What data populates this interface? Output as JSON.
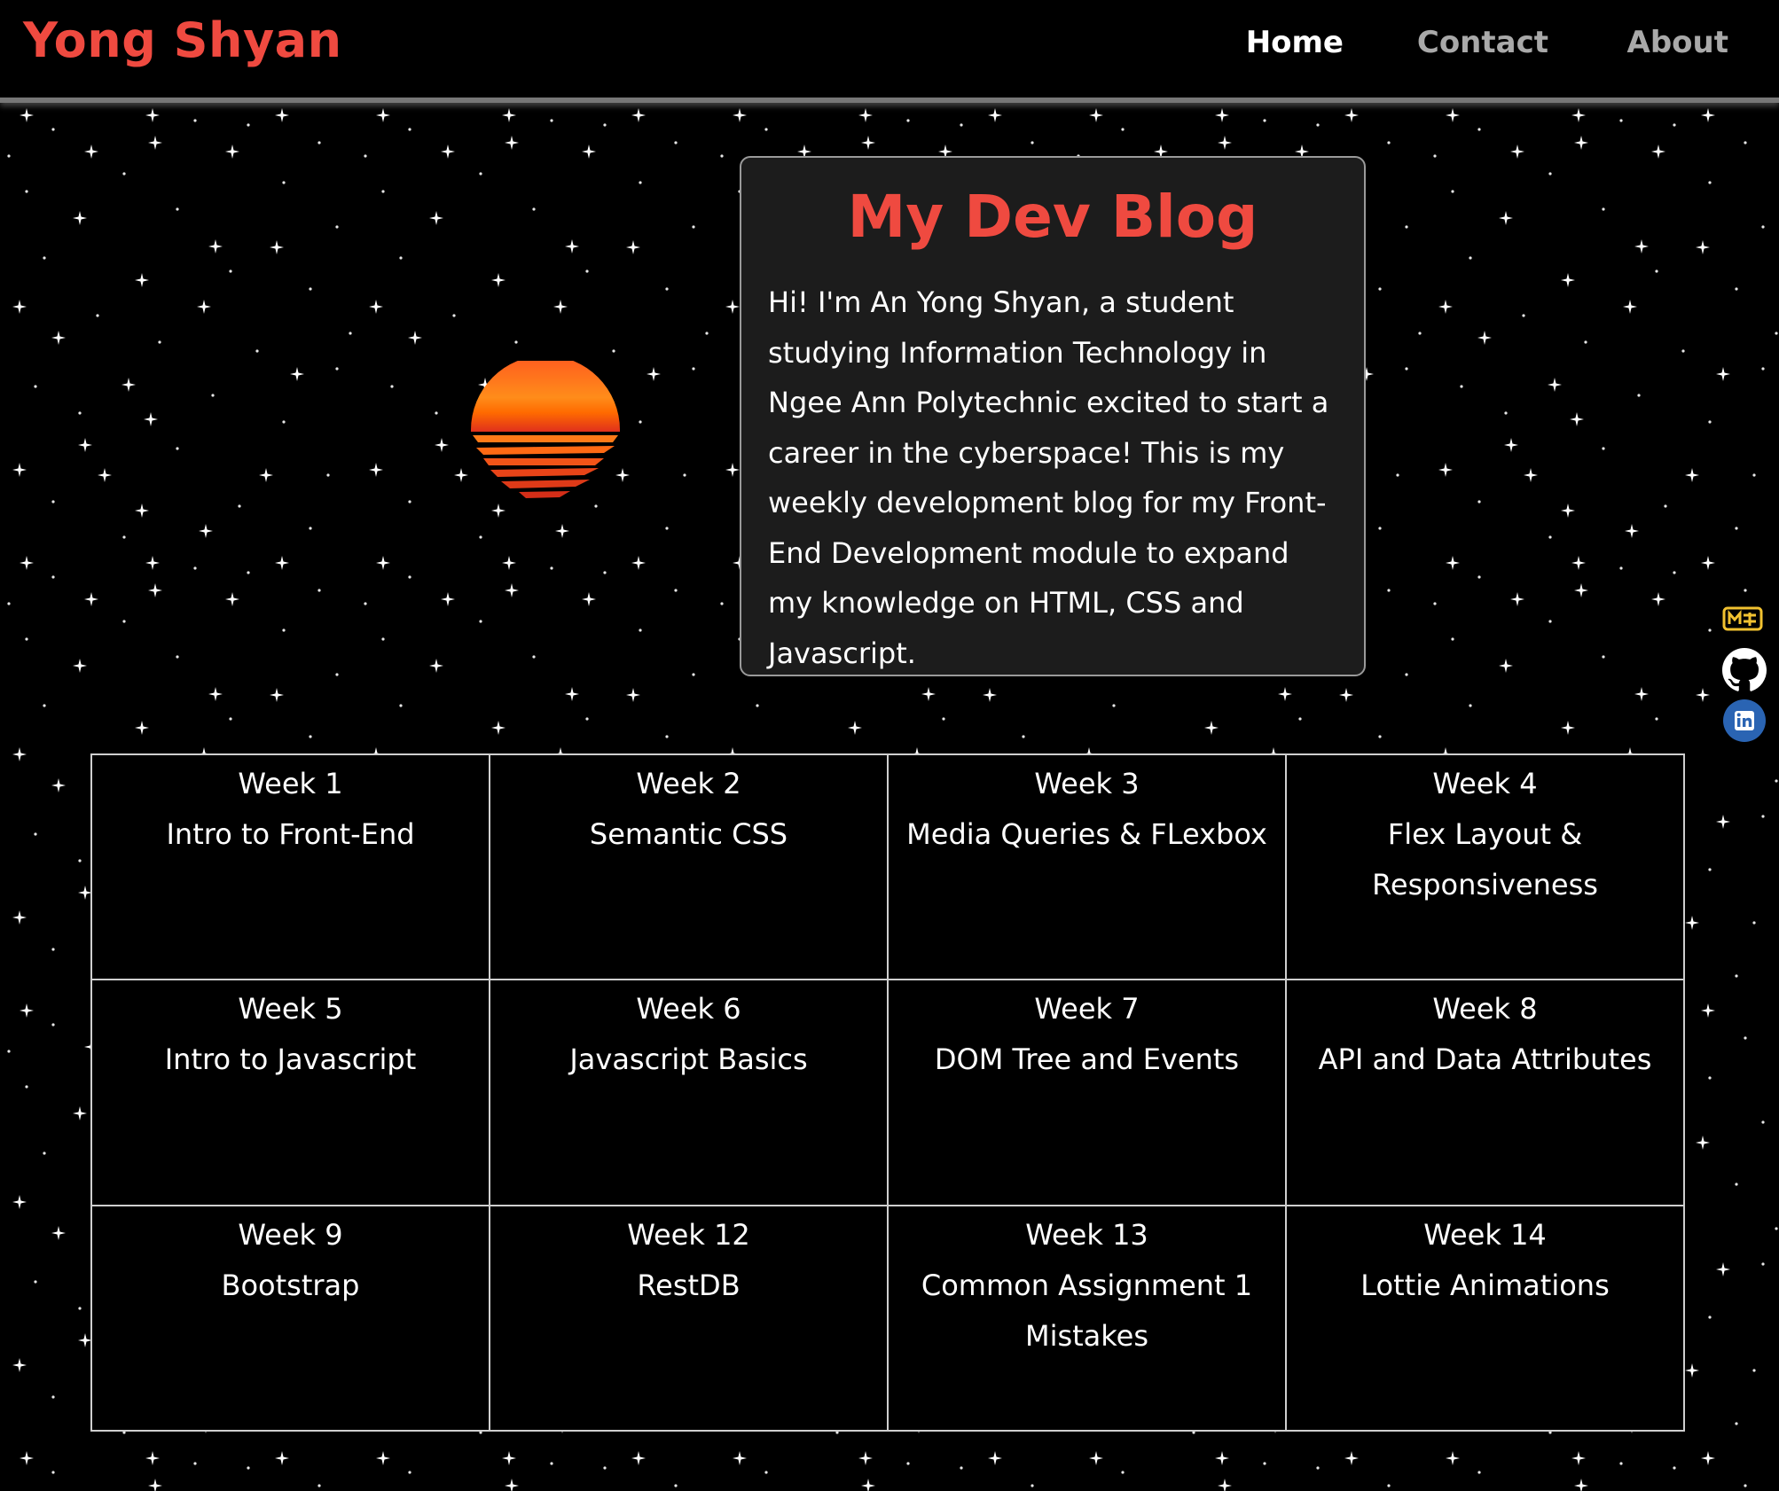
{
  "header": {
    "brand": "Yong Shyan",
    "nav": {
      "home": "Home",
      "contact": "Contact",
      "about": "About"
    }
  },
  "intro": {
    "title": "My Dev Blog",
    "text": "Hi! I'm An Yong Shyan, a student studying Information Technology in Ngee Ann Polytechnic excited to start a career in the cyberspace! This is my weekly development blog for my Front-End Development module to expand my knowledge on HTML, CSS and Javascript."
  },
  "weeks": [
    {
      "week": "Week 1",
      "topic": "Intro to Front-End"
    },
    {
      "week": "Week 2",
      "topic": "Semantic CSS"
    },
    {
      "week": "Week 3",
      "topic": "Media Queries & FLexbox"
    },
    {
      "week": "Week 4",
      "topic": "Flex Layout & Responsiveness"
    },
    {
      "week": "Week 5",
      "topic": "Intro to Javascript"
    },
    {
      "week": "Week 6",
      "topic": "Javascript Basics"
    },
    {
      "week": "Week 7",
      "topic": "DOM Tree and Events"
    },
    {
      "week": "Week 8",
      "topic": "API and Data Attributes"
    },
    {
      "week": "Week 9",
      "topic": "Bootstrap"
    },
    {
      "week": "Week 12",
      "topic": "RestDB"
    },
    {
      "week": "Week 13",
      "topic": "Common Assignment 1 Mistakes"
    },
    {
      "week": "Week 14",
      "topic": "Lottie Animations"
    }
  ],
  "social": [
    "markdown-icon",
    "github-icon",
    "linkedin-icon"
  ],
  "colors": {
    "accent": "#ef4a40",
    "background": "#000000",
    "card": "#1c1c1c",
    "nav_inactive": "#a9a9a9"
  }
}
